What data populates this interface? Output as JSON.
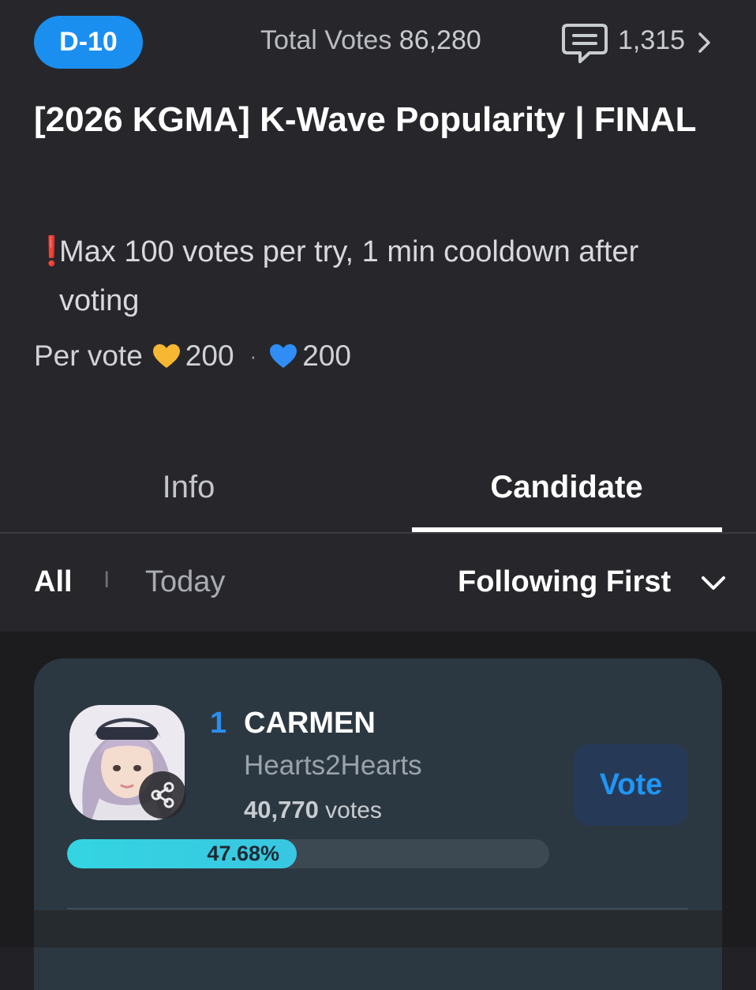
{
  "header": {
    "dday": "D-10",
    "total_votes_label": "Total Votes",
    "total_votes_value": "86,280",
    "comment_count": "1,315"
  },
  "event": {
    "title": "[2026 KGMA] K-Wave Popularity | FINAL",
    "notice_mark": "❗",
    "notice": "Max 100 votes per try, 1 min cooldown after voting",
    "per_vote_label": "Per vote",
    "cost_gold": "200",
    "cost_dot": "·",
    "cost_blue": "200",
    "heart_colors": {
      "gold": "#f7b733",
      "blue": "#2f8df5"
    }
  },
  "tabs": [
    {
      "label": "Info",
      "active": false
    },
    {
      "label": "Candidate",
      "active": true
    }
  ],
  "filters": {
    "all": "All",
    "separator": "I",
    "today": "Today",
    "sort": "Following First"
  },
  "candidates": [
    {
      "rank": "1",
      "name": "CARMEN",
      "group": "Hearts2Hearts",
      "votes_number": "40,770",
      "votes_unit": "votes",
      "percent_label": "47.68%",
      "percent": 47.68,
      "vote_button": "Vote"
    }
  ],
  "colors": {
    "accent": "#1a8ff0",
    "background": "#27272b",
    "card": "#2c3841",
    "bar": "#34d5e2",
    "notice_red": "#ff3b3b"
  },
  "icons": [
    "comment-icon",
    "chevron-right-icon",
    "heart-gold-icon",
    "heart-blue-icon",
    "chevron-down-icon",
    "share-icon"
  ]
}
